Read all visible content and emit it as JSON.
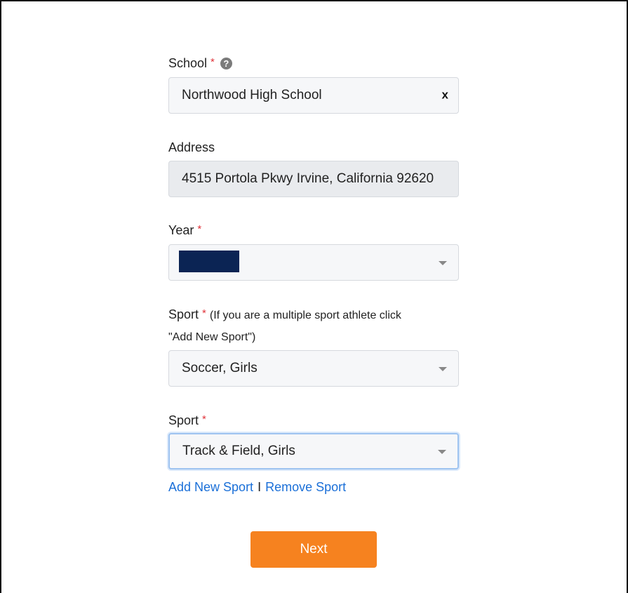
{
  "school": {
    "label": "School",
    "required_mark": "*",
    "help_icon": "question-circle-icon",
    "value": "Northwood High School",
    "clear_label": "x"
  },
  "address": {
    "label": "Address",
    "value": "4515 Portola Pkwy Irvine, California 92620"
  },
  "year": {
    "label": "Year",
    "required_mark": "*",
    "value": "",
    "dropdown_icon": "caret-down-icon"
  },
  "sport1": {
    "label": "Sport",
    "required_mark": "*",
    "note_line1": "(If you are a multiple sport athlete click",
    "note_line2": "\"Add New Sport\")",
    "value": "Soccer, Girls",
    "dropdown_icon": "caret-down-icon"
  },
  "sport2": {
    "label": "Sport",
    "required_mark": "*",
    "value": "Track & Field, Girls",
    "dropdown_icon": "caret-down-icon"
  },
  "links": {
    "add_sport": "Add New Sport",
    "separator": "I",
    "remove_sport": "Remove Sport"
  },
  "actions": {
    "next_label": "Next"
  },
  "colors": {
    "accent": "#f6821f",
    "link": "#1a6fd8",
    "required": "#e0333a",
    "redaction": "#0b2454"
  }
}
